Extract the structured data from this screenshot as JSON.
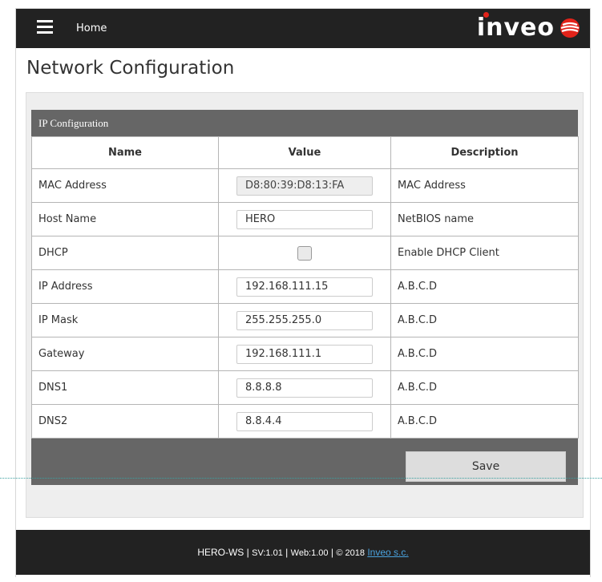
{
  "header": {
    "home_label": "Home",
    "logo_text": "inveo"
  },
  "page": {
    "title": "Network Configuration"
  },
  "ip_config": {
    "caption": "IP Configuration",
    "columns": [
      "Name",
      "Value",
      "Description"
    ],
    "rows": [
      {
        "name": "MAC Address",
        "value": "D8:80:39:D8:13:FA",
        "description": "MAC Address"
      },
      {
        "name": "Host Name",
        "value": "HERO",
        "description": "NetBIOS name"
      },
      {
        "name": "DHCP",
        "checked": false,
        "description": "Enable DHCP Client"
      },
      {
        "name": "IP Address",
        "value": "192.168.111.15",
        "description": "A.B.C.D"
      },
      {
        "name": "IP Mask",
        "value": "255.255.255.0",
        "description": "A.B.C.D"
      },
      {
        "name": "Gateway",
        "value": "192.168.111.1",
        "description": "A.B.C.D"
      },
      {
        "name": "DNS1",
        "value": "8.8.8.8",
        "description": "A.B.C.D"
      },
      {
        "name": "DNS2",
        "value": "8.8.4.4",
        "description": "A.B.C.D"
      }
    ],
    "save_label": "Save"
  },
  "footer": {
    "device": "HERO-WS",
    "sep": " | ",
    "sv": "SV:1.01",
    "web": "Web:1.00",
    "copyright": "© 2018",
    "link_text": "Inveo s.c."
  },
  "colors": {
    "topbar": "#222222",
    "brand_red": "#e2231a",
    "table_header": "#666666",
    "link": "#4aa3df"
  }
}
